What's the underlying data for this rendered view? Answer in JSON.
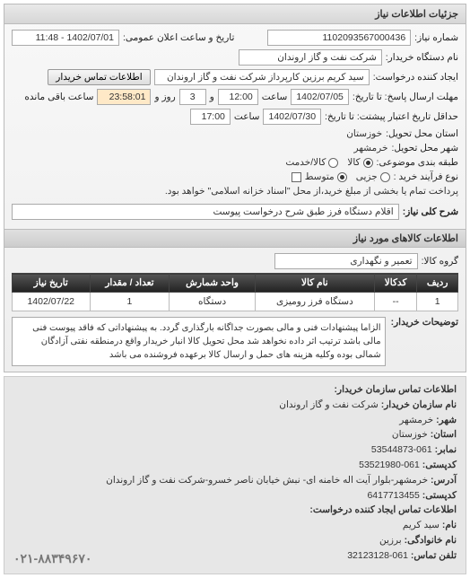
{
  "panel_title": "جزئیات اطلاعات نیاز",
  "fields": {
    "req_no_label": "شماره نیاز:",
    "req_no": "1102093567000436",
    "announce_label": "تاریخ و ساعت اعلان عمومی:",
    "announce": "1402/07/01 - 11:48",
    "org_label": "نام دستگاه خریدار:",
    "org": "شرکت نفت و گاز اروندان",
    "creator_label": "ایجاد کننده درخواست:",
    "creator": "سید کریم برزین کارپرداز شرکت نفت و گاز اروندان",
    "contact_btn": "اطلاعات تماس خریدار",
    "resp_until_label": "مهلت ارسال پاسخ: تا تاریخ:",
    "resp_date": "1402/07/05",
    "resp_time_label": "ساعت",
    "resp_time": "12:00",
    "days_and": "و",
    "days_val": "3",
    "days_label": "روز و",
    "remain_time": "23:58:01",
    "remain_label": "ساعت باقی مانده",
    "valid_label": "حداقل تاریخ اعتبار پیشتت: تا تاریخ:",
    "valid_date": "1402/07/30",
    "valid_time_label": "ساعت",
    "valid_time": "17:00",
    "province_label": "استان محل تحویل:",
    "province": "خوزستان",
    "city_label": "شهر محل تحویل:",
    "city": "خرمشهر",
    "budget_label": "طبقه بندی موضوعی:",
    "budget_opts": [
      "کالا",
      "کالا/خدمت"
    ],
    "budget_sel": 0,
    "process_label": "نوع فرآیند خرید :",
    "process_opts": [
      "جزیی",
      "متوسط"
    ],
    "process_sel": 1,
    "pay_note_check_label": "پرداخت تمام یا بخشی از مبلغ خرید،از محل \"اسناد خزانه اسلامی\" خواهد بود.",
    "summary_label": "شرح کلی نیاز:",
    "summary": "اقلام دستگاه فرز طبق شرح درخواست پیوست"
  },
  "goods_header": "اطلاعات کالاهای مورد نیاز",
  "group_label": "گروه کالا:",
  "group_val": "تعمیر و نگهداری",
  "table": {
    "headers": [
      "ردیف",
      "کدکالا",
      "نام کالا",
      "واحد شمارش",
      "تعداد / مقدار",
      "تاریخ نیاز"
    ],
    "rows": [
      [
        "1",
        "--",
        "دستگاه فرز رومیزی",
        "دستگاه",
        "1",
        "1402/07/22"
      ]
    ]
  },
  "buyer_desc_label": "توضیحات خریدار:",
  "buyer_desc": "الزاما پیشنهادات فنی و مالی بصورت جداگانه بارگذاری گردد. به پیشنهاداتی که فاقد پیوست فنی مالی باشد ترتیب اثر داده نخواهد شد محل تحویل کالا انبار خریدار واقع درمنطقه نفتی آزادگان شمالی بوده وکلیه هزینه های حمل و ارسال کالا برعهده فروشنده می باشد",
  "contact": {
    "title": "اطلاعات تماس سازمان خریدار:",
    "org_name_label": "نام سازمان خریدار:",
    "org_name": "شرکت نفت و گاز اروندان",
    "city_label": "شهر:",
    "city": "خرمشهر",
    "province_label": "استان:",
    "province": "خوزستان",
    "fax_label": "نمابر:",
    "fax": "061-53544873",
    "postal_label": "کدپستی:",
    "postal": "061-53521980",
    "address_label": "آدرس:",
    "address": "خرمشهر-بلوار آیت اله خامنه ای- نبش خیابان ناصر خسرو-شرکت نفت و گاز اروندان",
    "post2_label": "کدپستی:",
    "post2": "6417713455",
    "creator_title": "اطلاعات تماس ایجاد کننده درخواست:",
    "name_label": "نام:",
    "name": "سید کریم",
    "family_label": "نام خانوادگی:",
    "family": "برزین",
    "phone_label": "تلفن تماس:",
    "phone": "061-32123128",
    "footer_phone": "۰۲۱-۸۸۳۴۹۶۷۰"
  }
}
